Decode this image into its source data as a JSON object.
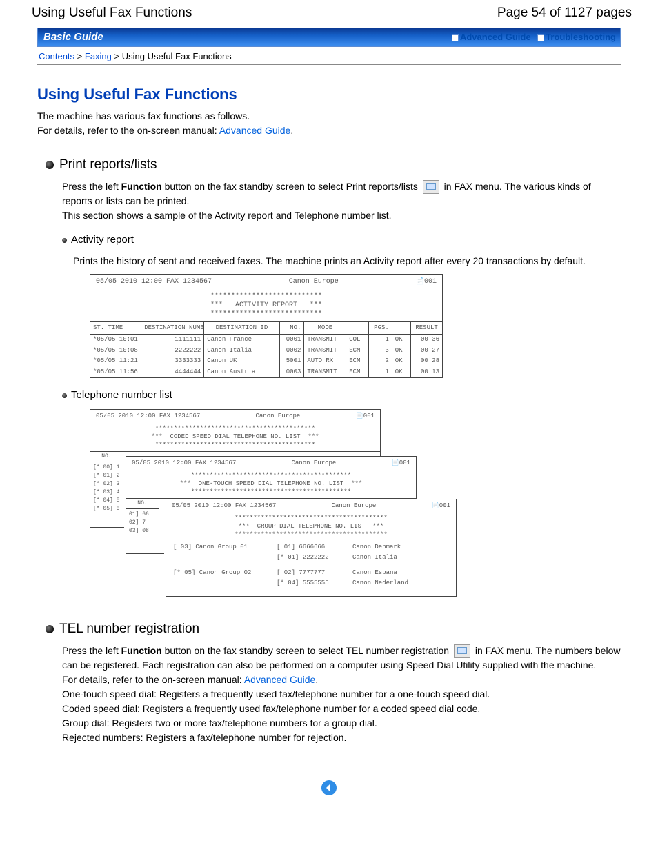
{
  "header": {
    "title_left": "Using Useful Fax Functions",
    "title_right": "Page 54 of 1127 pages"
  },
  "banner": {
    "label": "Basic Guide",
    "link_advanced": "Advanced Guide",
    "link_trouble": "Troubleshooting"
  },
  "crumbs": {
    "contents": "Contents",
    "faxing": "Faxing",
    "current": "Using Useful Fax Functions",
    "sep": " > "
  },
  "page_title": "Using Useful Fax Functions",
  "intro": {
    "line1": "The machine has various fax functions as follows.",
    "line2": "For details, refer to the on-screen manual: ",
    "link": "Advanced Guide",
    "period": "."
  },
  "section1": {
    "title": "Print reports/lists",
    "para1a": "Press the left ",
    "functionWord": "Function",
    "para1b": " button on the fax standby screen to select Print reports/lists ",
    "para1c": " in FAX menu. The various kinds of reports or lists can be printed.",
    "para2": "This section shows a sample of the Activity report and Telephone number list.",
    "sub1": {
      "title": "Activity report",
      "body": "Prints the history of sent and received faxes. The machine prints an Activity report after every 20 transactions by default."
    },
    "sub2": {
      "title": "Telephone number list"
    }
  },
  "activity_report": {
    "stamp": "05/05 2010 12:00 FAX 1234567",
    "owner": "Canon Europe",
    "page": "001",
    "title": "ACTIVITY REPORT",
    "stars": "***************************",
    "side_stars": "***",
    "cols": [
      "ST. TIME",
      "DESTINATION NUMBER",
      "DESTINATION ID",
      "NO.",
      "MODE",
      "",
      "PGS.",
      "",
      "RESULT"
    ],
    "rows": [
      [
        "*05/05 10:01",
        "1111111",
        "Canon France",
        "0001",
        "TRANSMIT",
        "COL",
        "1",
        "OK",
        "00'36"
      ],
      [
        "*05/05 10:08",
        "2222222",
        "Canon Italia",
        "0002",
        "TRANSMIT",
        "ECM",
        "3",
        "OK",
        "00'27"
      ],
      [
        "*05/05 11:21",
        "3333333",
        "Canon UK",
        "5001",
        "AUTO RX",
        "ECM",
        "2",
        "OK",
        "00'28"
      ],
      [
        "*05/05 11:56",
        "4444444",
        "Canon Austria",
        "0003",
        "TRANSMIT",
        "ECM",
        "1",
        "OK",
        "00'13"
      ]
    ]
  },
  "tel_list": {
    "stamp": "05/05 2010 12:00 FAX 1234567",
    "owner": "Canon Europe",
    "page": "001",
    "titles": {
      "coded": "CODED SPEED DIAL TELEPHONE NO. LIST",
      "onetouch": "ONE-TOUCH SPEED DIAL TELEPHONE NO. LIST",
      "group": "GROUP DIAL TELEPHONE NO. LIST"
    },
    "no_label": "NO.",
    "codes": [
      "[* 00] 1",
      "[* 01] 2",
      "[* 02] 3",
      "[* 03] 4",
      "[* 04] 5",
      "[* 05] 0"
    ],
    "onetouch_codes": [
      "01] 66",
      "02] 7",
      "03] 08"
    ],
    "stars_long": "*******************************************",
    "stars_med": "*****************************************",
    "side_stars": "***",
    "group_rows": [
      {
        "left": "[  03] Canon Group 01",
        "mid": "[  01] 6666666",
        "right": "Canon Denmark"
      },
      {
        "left": "",
        "mid": "[* 01] 2222222",
        "right": "Canon Italia"
      },
      {
        "left": "[* 05] Canon Group 02",
        "mid": "[  02] 7777777",
        "right": "Canon Espana"
      },
      {
        "left": "",
        "mid": "[* 04] 5555555",
        "right": "Canon Nederland"
      }
    ]
  },
  "section2": {
    "title": "TEL number registration",
    "para1a": "Press the left ",
    "functionWord": "Function",
    "para1b": " button on the fax standby screen to select TEL number registration ",
    "para1c": " in FAX menu. The numbers below can be registered. Each registration can also be performed on a computer using Speed Dial Utility supplied with the machine.",
    "para2": "For details, refer to the on-screen manual: ",
    "link": "Advanced Guide",
    "period": ".",
    "list": [
      "One-touch speed dial: Registers a frequently used fax/telephone number for a one-touch speed dial.",
      "Coded speed dial: Registers a frequently used fax/telephone number for a coded speed dial code.",
      "Group dial: Registers two or more fax/telephone numbers for a group dial.",
      "Rejected numbers: Registers a fax/telephone number for rejection."
    ]
  },
  "page_icon": "page-icon",
  "stars3": "***"
}
